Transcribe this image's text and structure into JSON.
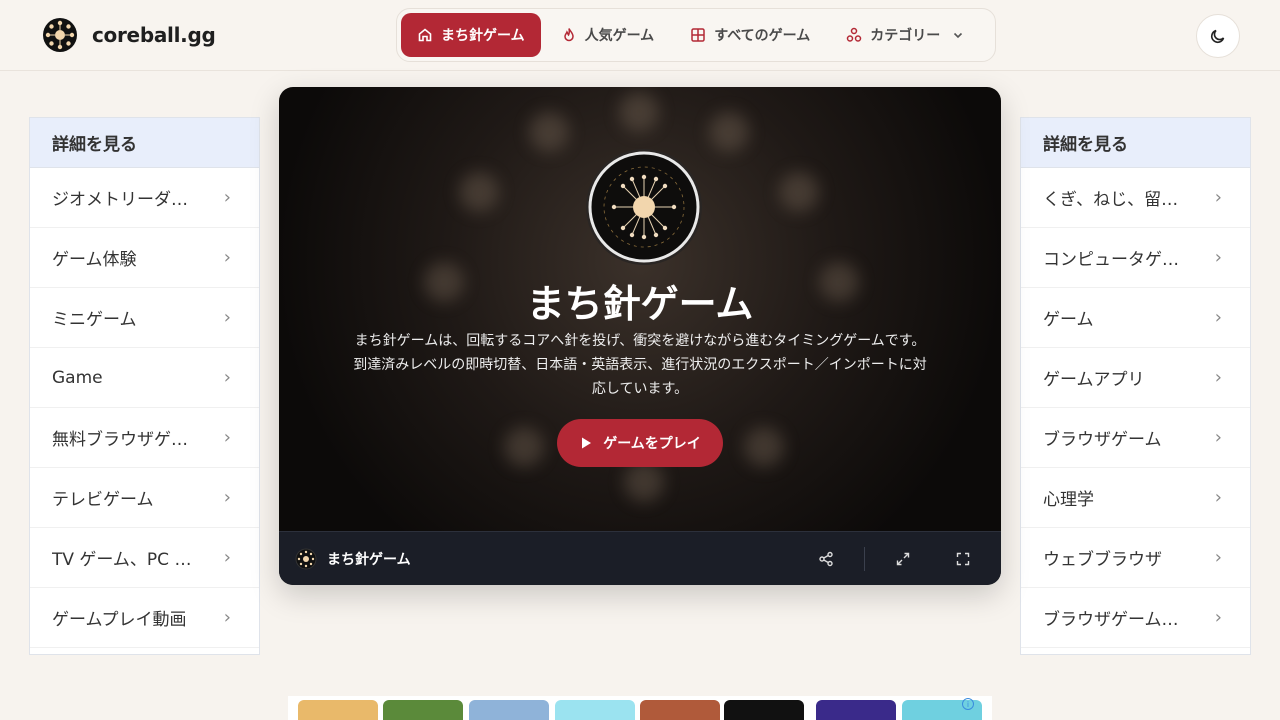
{
  "brand": {
    "name": "coreball.gg"
  },
  "nav": {
    "items": [
      {
        "label": "まち針ゲーム",
        "icon": "home-icon",
        "active": true
      },
      {
        "label": "人気ゲーム",
        "icon": "flame-icon",
        "active": false
      },
      {
        "label": "すべてのゲーム",
        "icon": "grid-icon",
        "active": false
      },
      {
        "label": "カテゴリー",
        "icon": "categories-icon",
        "active": false
      }
    ],
    "theme_toggle_icon": "moon-icon"
  },
  "left_panel": {
    "title": "詳細を見る",
    "items": [
      "ジオメトリーダッシュ",
      "ゲーム体験",
      "ミニゲーム",
      "Game",
      "無料ブラウザゲーム",
      "テレビゲーム",
      "TV ゲーム、PC ゲーム",
      "ゲームプレイ動画"
    ]
  },
  "right_panel": {
    "title": "詳細を見る",
    "items": [
      "くぎ、ねじ、留め具",
      "コンピュータゲーム",
      "ゲーム",
      "ゲームアプリ",
      "ブラウザゲーム",
      "心理学",
      "ウェブブラウザ",
      "ブラウザゲームリスト"
    ]
  },
  "game": {
    "title": "まち針ゲーム",
    "description": "まち針ゲームは、回転するコアへ針を投げ、衝突を避けながら進むタイミングゲームです。到達済みレベルの即時切替、日本語・英語表示、進行状況のエクスポート／インポートに対応しています。",
    "play_label": "ゲームをプレイ",
    "bar_title": "まち針ゲーム",
    "bar_icons": [
      "share-icon",
      "expand-icon",
      "fullscreen-icon"
    ]
  },
  "colors": {
    "accent": "#b32835",
    "background": "#f7f3ee",
    "panel_header": "#e8eefb",
    "game_bar": "#1b1e27"
  }
}
